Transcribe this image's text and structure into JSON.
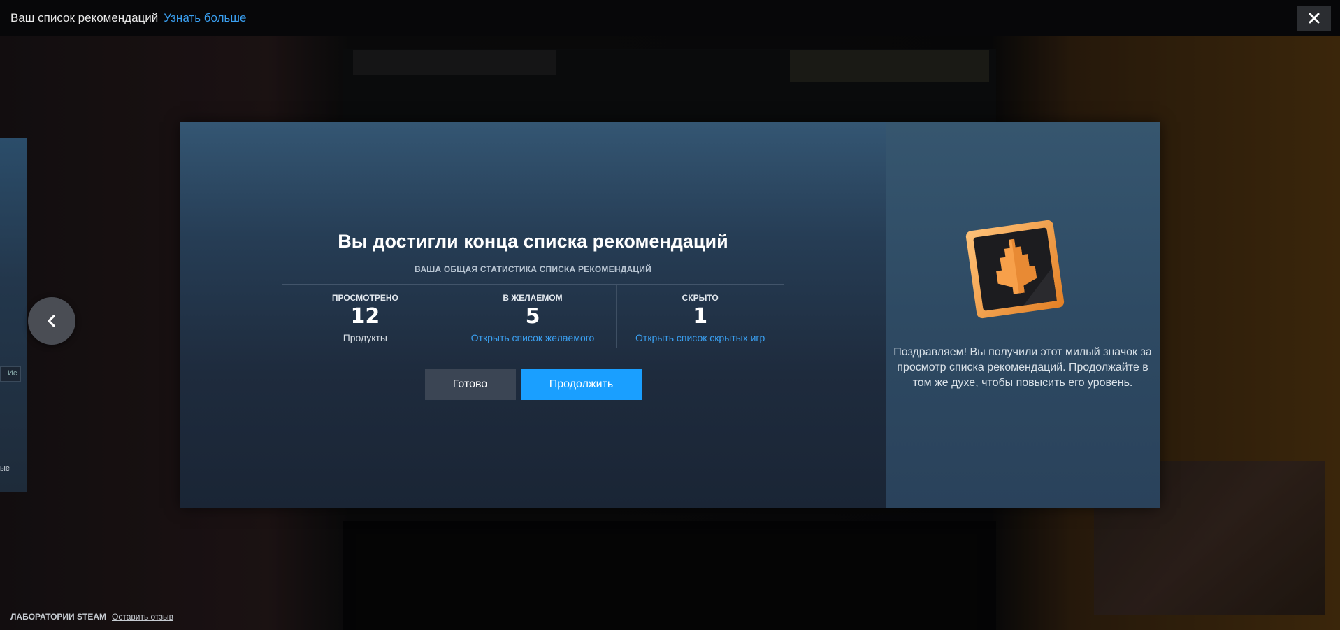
{
  "top_bar": {
    "title": "Ваш список рекомендаций",
    "learn_more": "Узнать больше"
  },
  "prev_card": {
    "tab_label": "Ис",
    "snippet": "ые"
  },
  "modal": {
    "title": "Вы достигли конца списка рекомендаций",
    "stats_subtitle": "ВАША ОБЩАЯ СТАТИСТИКА СПИСКА РЕКОМЕНДАЦИЙ",
    "stats": [
      {
        "label": "ПРОСМОТРЕНО",
        "value": "12",
        "sub": "Продукты"
      },
      {
        "label": "В ЖЕЛАЕМОМ",
        "value": "5",
        "link": "Открыть список желаемого"
      },
      {
        "label": "СКРЫТО",
        "value": "1",
        "link": "Открыть список скрытых игр"
      }
    ],
    "done_button": "Готово",
    "continue_button": "Продолжить"
  },
  "side": {
    "badge_icon": "discovery-queue-badge-icon",
    "text": "Поздравляем! Вы получили этот милый значок за просмотр списка рекомендаций. Продолжайте в том же духе, чтобы повысить его уровень."
  },
  "footer": {
    "label": "ЛАБОРАТОРИИ STEAM",
    "link": "Оставить отзыв"
  },
  "colors": {
    "accent": "#1a9fff",
    "link": "#3a9ff0",
    "badge_orange": "#f7a04a"
  }
}
